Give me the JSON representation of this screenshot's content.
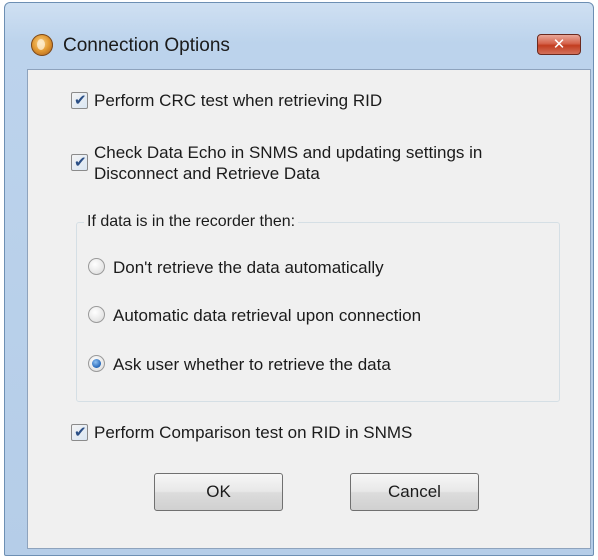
{
  "window": {
    "title": "Connection Options",
    "close_label": "✕",
    "icon": "app-icon"
  },
  "options": {
    "crc_test": {
      "label": "Perform CRC test when retrieving RID",
      "checked": true
    },
    "data_echo": {
      "label_line1": "Check Data Echo in SNMS and updating settings in",
      "label_line2": "Disconnect and Retrieve Data",
      "checked": true
    },
    "comparison_test": {
      "label": "Perform Comparison test on  RID in SNMS",
      "checked": true
    }
  },
  "group": {
    "title": "If data is in the recorder then:",
    "radios": [
      {
        "label": "Don't retrieve the data automatically",
        "selected": false
      },
      {
        "label": "Automatic data retrieval upon connection",
        "selected": false
      },
      {
        "label": "Ask user whether to retrieve the data",
        "selected": true
      }
    ]
  },
  "buttons": {
    "ok": "OK",
    "cancel": "Cancel"
  },
  "colors": {
    "frame": "#bcd3ec",
    "client": "#f0f0f0",
    "close": "#c23d20",
    "radio_accent": "#2466b8"
  }
}
